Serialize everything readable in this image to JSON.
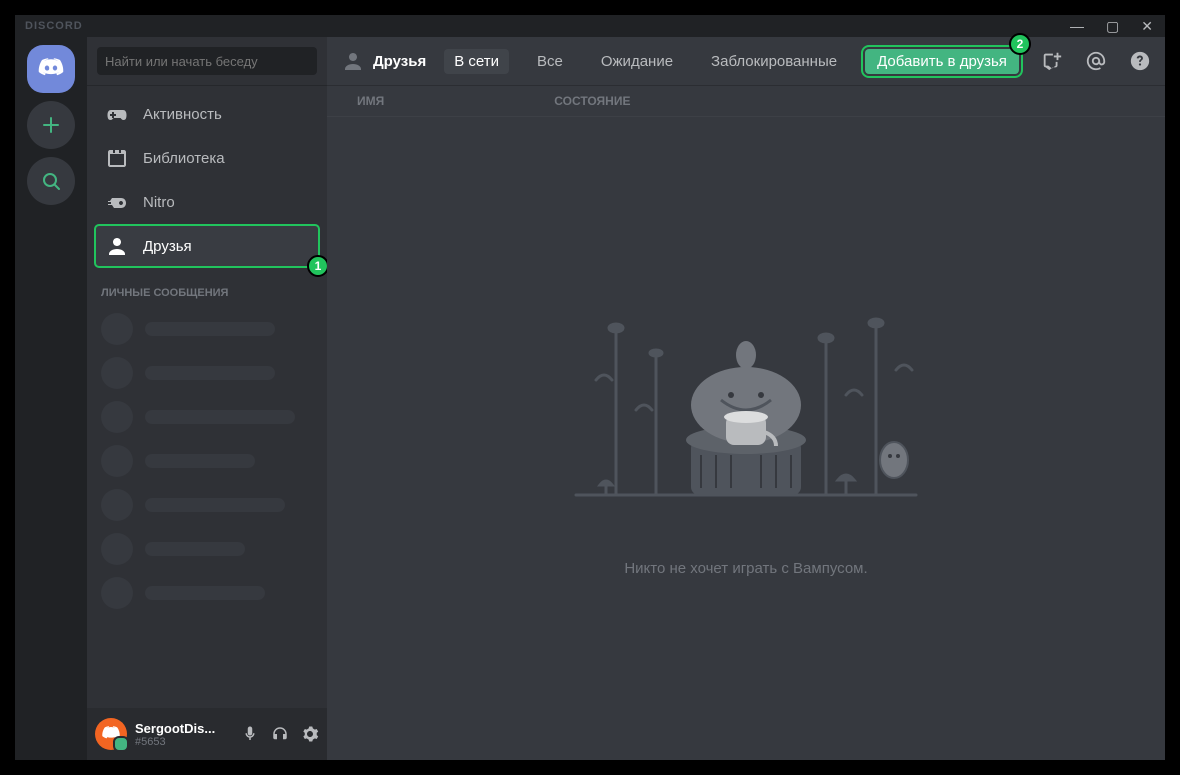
{
  "titlebar": {
    "app_name": "DISCORD"
  },
  "sidebar": {
    "search_placeholder": "Найти или начать беседу",
    "items": [
      {
        "label": "Активность",
        "icon": "gamepad-icon"
      },
      {
        "label": "Библиотека",
        "icon": "library-icon"
      },
      {
        "label": "Nitro",
        "icon": "nitro-icon"
      },
      {
        "label": "Друзья",
        "icon": "friends-icon"
      }
    ],
    "dm_header": "ЛИЧНЫЕ СООБЩЕНИЯ"
  },
  "user": {
    "name": "SergootDis...",
    "tag": "#5653"
  },
  "header": {
    "title": "Друзья",
    "tabs": {
      "online": "В сети",
      "all": "Все",
      "pending": "Ожидание",
      "blocked": "Заблокированные"
    },
    "add_friend": "Добавить в друзья"
  },
  "table": {
    "name_col": "ИМЯ",
    "status_col": "СОСТОЯНИЕ"
  },
  "empty": {
    "message": "Никто не хочет играть с Вампусом."
  },
  "annotations": {
    "step1": "1",
    "step2": "2"
  }
}
